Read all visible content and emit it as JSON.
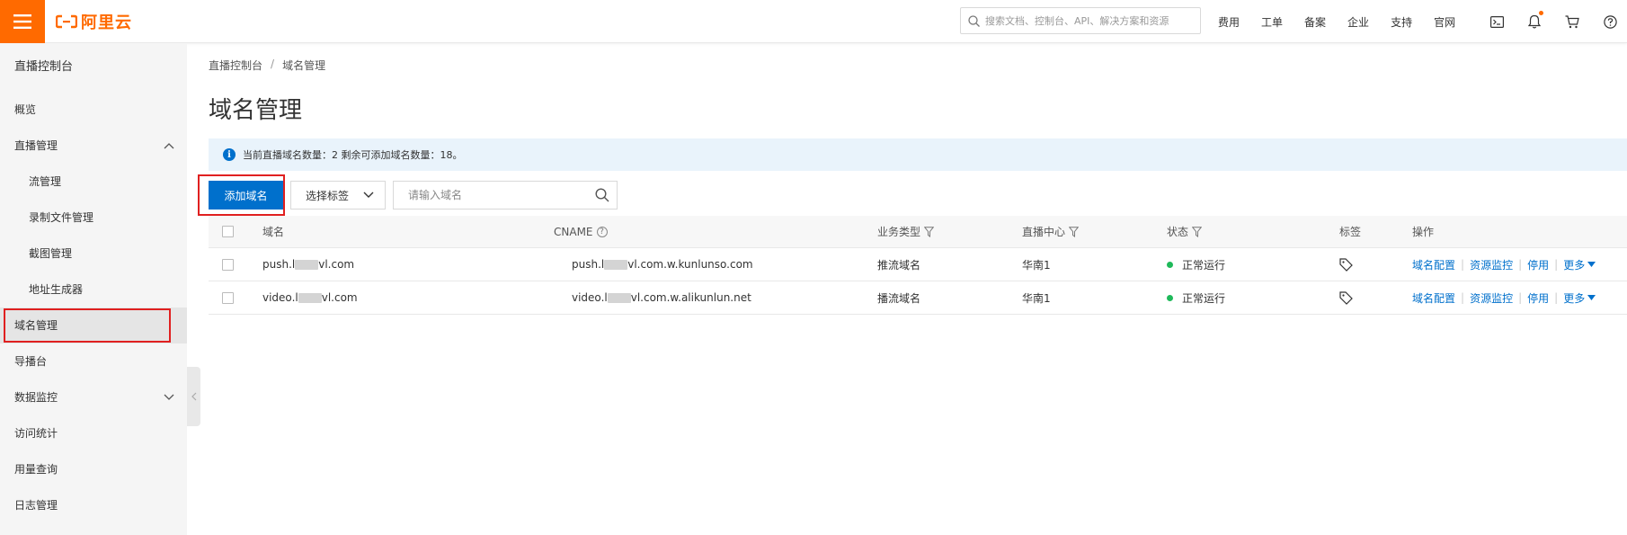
{
  "header": {
    "logo_text": "阿里云",
    "search_placeholder": "搜索文档、控制台、API、解决方案和资源",
    "nav": [
      "费用",
      "工单",
      "备案",
      "企业",
      "支持",
      "官网"
    ],
    "icons": [
      "terminal-icon",
      "bell-icon",
      "cart-icon",
      "help-icon"
    ],
    "accent_color": "#ff6a00"
  },
  "sidebar": {
    "title": "直播控制台",
    "items": [
      {
        "label": "概览"
      },
      {
        "label": "直播管理"
      },
      {
        "label": "流管理"
      },
      {
        "label": "录制文件管理"
      },
      {
        "label": "截图管理"
      },
      {
        "label": "地址生成器"
      },
      {
        "label": "域名管理"
      },
      {
        "label": "导播台"
      },
      {
        "label": "数据监控"
      },
      {
        "label": "访问统计"
      },
      {
        "label": "用量查询"
      },
      {
        "label": "日志管理"
      }
    ]
  },
  "main": {
    "breadcrumb": [
      "直播控制台",
      "/",
      "域名管理"
    ],
    "title": "域名管理",
    "notice": "当前直播域名数量：2 剩余可添加域名数量：18。",
    "add_button": "添加域名",
    "tag_select": "选择标签",
    "domain_search_placeholder": "请输入域名",
    "table": {
      "headers": {
        "domain": "域名",
        "cname": "CNAME",
        "type": "业务类型",
        "center": "直播中心",
        "status": "状态",
        "tag": "标签",
        "ops": "操作"
      },
      "rows": [
        {
          "domain_prefix": "push.l",
          "domain_suffix": "vl.com",
          "cname_prefix": "push.l",
          "cname_suffix": "vl.com.w.kunlunso.com",
          "type": "推流域名",
          "center": "华南1",
          "status": "正常运行"
        },
        {
          "domain_prefix": "video.l",
          "domain_suffix": "vl.com",
          "cname_prefix": "video.l",
          "cname_suffix": "vl.com.w.alikunlun.net",
          "type": "播流域名",
          "center": "华南1",
          "status": "正常运行"
        }
      ],
      "ops": [
        "域名配置",
        "资源监控",
        "停用",
        "更多"
      ]
    }
  }
}
